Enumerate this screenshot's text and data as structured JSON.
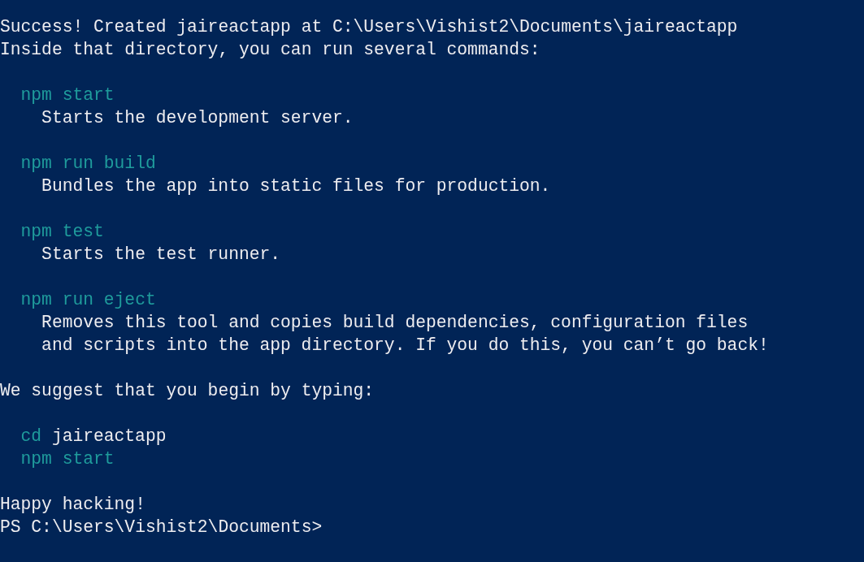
{
  "terminal": {
    "lines": [
      {
        "kind": "output",
        "segments": [
          {
            "text": "Success! Created jaireactapp at C:\\Users\\Vishist2\\Documents\\jaireactapp",
            "kind": "plain"
          }
        ]
      },
      {
        "kind": "output",
        "segments": [
          {
            "text": "Inside that directory, you can run several commands:",
            "kind": "plain"
          }
        ]
      },
      {
        "kind": "blank"
      },
      {
        "kind": "command",
        "segments": [
          {
            "text": "npm start",
            "kind": "command"
          }
        ]
      },
      {
        "kind": "detail",
        "segments": [
          {
            "text": "Starts the development server.",
            "kind": "plain"
          }
        ]
      },
      {
        "kind": "blank"
      },
      {
        "kind": "command",
        "segments": [
          {
            "text": "npm run build",
            "kind": "command"
          }
        ]
      },
      {
        "kind": "detail",
        "segments": [
          {
            "text": "Bundles the app into static files for production.",
            "kind": "plain"
          }
        ]
      },
      {
        "kind": "blank"
      },
      {
        "kind": "command",
        "segments": [
          {
            "text": "npm test",
            "kind": "command"
          }
        ]
      },
      {
        "kind": "detail",
        "segments": [
          {
            "text": "Starts the test runner.",
            "kind": "plain"
          }
        ]
      },
      {
        "kind": "blank"
      },
      {
        "kind": "command",
        "segments": [
          {
            "text": "npm run eject",
            "kind": "command"
          }
        ]
      },
      {
        "kind": "detail",
        "segments": [
          {
            "text": "Removes this tool and copies build dependencies, configuration files",
            "kind": "plain"
          }
        ]
      },
      {
        "kind": "detail",
        "segments": [
          {
            "text": "and scripts into the app directory. If you do this, you can’t go back!",
            "kind": "plain"
          }
        ]
      },
      {
        "kind": "blank"
      },
      {
        "kind": "output",
        "segments": [
          {
            "text": "We suggest that you begin by typing:",
            "kind": "plain"
          }
        ]
      },
      {
        "kind": "blank"
      },
      {
        "kind": "command",
        "segments": [
          {
            "text": "cd",
            "kind": "command"
          },
          {
            "text": "jaireactapp",
            "kind": "plain"
          }
        ]
      },
      {
        "kind": "command",
        "segments": [
          {
            "text": "npm start",
            "kind": "command"
          }
        ]
      },
      {
        "kind": "blank"
      },
      {
        "kind": "output",
        "segments": [
          {
            "text": "Happy hacking!",
            "kind": "plain"
          }
        ]
      },
      {
        "kind": "output",
        "segments": [
          {
            "text": "PS C:\\Users\\Vishist2\\Documents>",
            "kind": "plain"
          }
        ]
      }
    ]
  }
}
